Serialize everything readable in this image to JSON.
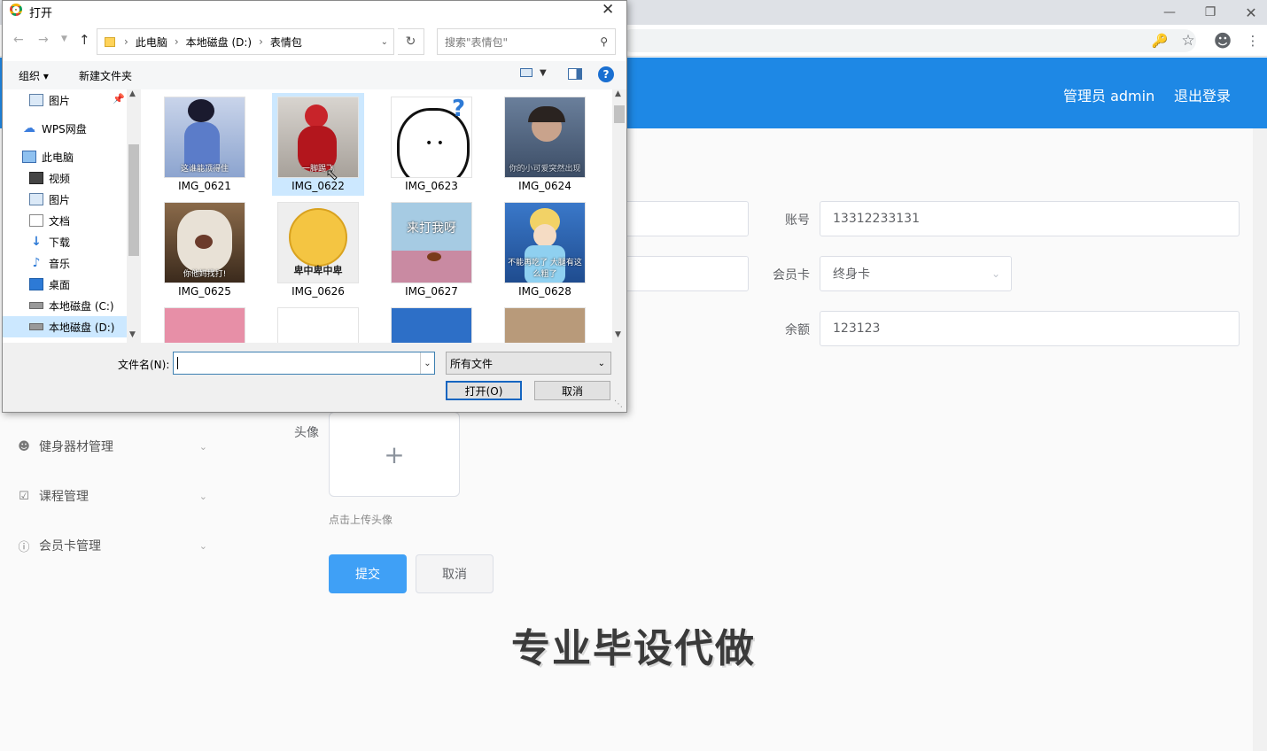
{
  "colors": {
    "accent": "#1e88e5",
    "primary_button": "#3fa0f6"
  },
  "dialog": {
    "title": "打开",
    "breadcrumb": [
      "此电脑",
      "本地磁盘 (D:)",
      "表情包"
    ],
    "search_placeholder": "搜索\"表情包\"",
    "organize_label": "组织",
    "new_folder_label": "新建文件夹",
    "nav_items": [
      {
        "label": "图片",
        "icon": "pictures-icon"
      },
      {
        "label": "WPS网盘",
        "icon": "cloud-icon"
      },
      {
        "label": "此电脑",
        "icon": "computer-icon"
      },
      {
        "label": "视频",
        "icon": "video-icon"
      },
      {
        "label": "图片",
        "icon": "pictures-icon"
      },
      {
        "label": "文档",
        "icon": "document-icon"
      },
      {
        "label": "下载",
        "icon": "download-icon"
      },
      {
        "label": "音乐",
        "icon": "music-icon"
      },
      {
        "label": "桌面",
        "icon": "desktop-icon"
      },
      {
        "label": "本地磁盘 (C:)",
        "icon": "drive-icon"
      },
      {
        "label": "本地磁盘 (D:)",
        "icon": "drive-icon"
      }
    ],
    "files": [
      {
        "name": "IMG_0621",
        "caption": "这谁能顶得住"
      },
      {
        "name": "IMG_0622",
        "caption": "一脚踢飞"
      },
      {
        "name": "IMG_0623",
        "caption": ""
      },
      {
        "name": "IMG_0624",
        "caption": "你的小可爱突然出现"
      },
      {
        "name": "IMG_0625",
        "caption": "你他妈找打!"
      },
      {
        "name": "IMG_0626",
        "caption": "卑中卑中卑"
      },
      {
        "name": "IMG_0627",
        "caption": "来打我呀"
      },
      {
        "name": "IMG_0628",
        "caption": "不能再吃了 大腿有这么粗了"
      }
    ],
    "filename_label": "文件名(N):",
    "filename_value": "",
    "filetype_value": "所有文件",
    "open_label": "打开(O)",
    "cancel_label": "取消"
  },
  "header": {
    "admin_label": "管理员 admin",
    "logout_label": "退出登录"
  },
  "sidebar": {
    "items": [
      "健身器材管理",
      "课程管理",
      "会员卡管理"
    ]
  },
  "form": {
    "account_label": "账号",
    "account_value": "13312233131",
    "card_label": "会员卡",
    "card_value": "终身卡",
    "balance_label": "余额",
    "balance_value": "123123",
    "avatar_label": "头像",
    "avatar_hint": "点击上传头像",
    "submit_label": "提交",
    "cancel_label": "取消"
  },
  "watermark": "专业毕设代做"
}
